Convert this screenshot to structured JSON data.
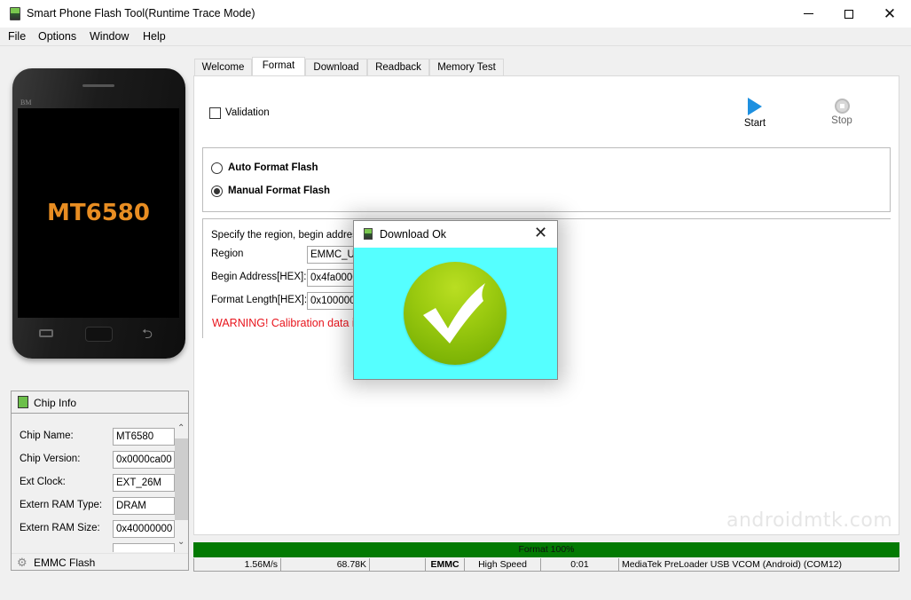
{
  "window": {
    "title": "Smart Phone Flash Tool(Runtime Trace Mode)",
    "controls": {
      "minimize": "minimize",
      "maximize": "maximize",
      "close": "✕"
    }
  },
  "menu": [
    "File",
    "Options",
    "Window",
    "Help"
  ],
  "phone": {
    "brand": "BM",
    "chip": "MT6580"
  },
  "chip_info": {
    "title": "Chip Info",
    "rows": [
      {
        "label": "Chip Name:",
        "value": "MT6580"
      },
      {
        "label": "Chip Version:",
        "value": "0x0000ca00"
      },
      {
        "label": "Ext Clock:",
        "value": "EXT_26M"
      },
      {
        "label": "Extern RAM Type:",
        "value": "DRAM"
      },
      {
        "label": "Extern RAM Size:",
        "value": "0x40000000"
      }
    ],
    "scroll_up": "^",
    "scroll_down": "v",
    "footer_label": "EMMC Flash"
  },
  "tabs": [
    {
      "label": "Welcome",
      "active": false
    },
    {
      "label": "Format",
      "active": true
    },
    {
      "label": "Download",
      "active": false
    },
    {
      "label": "Readback",
      "active": false
    },
    {
      "label": "Memory Test",
      "active": false
    }
  ],
  "format_tab": {
    "validation_label": "Validation",
    "validation_checked": false,
    "start_label": "Start",
    "stop_label": "Stop",
    "auto_format_label": "Auto Format Flash",
    "manual_format_label": "Manual Format Flash",
    "selected_mode": "Manual Format Flash",
    "manual_description": "Specify the region, begin address",
    "fields": [
      {
        "label": "Region",
        "value": "EMMC_USER"
      },
      {
        "label": "Begin Address[HEX]:",
        "value": "0x4fa0000"
      },
      {
        "label": "Format Length[HEX]:",
        "value": "0x100000"
      }
    ],
    "warning": "WARNING! Calibration data i"
  },
  "watermark": "androidmtk.com",
  "progress": {
    "label": "Format 100%",
    "percent": 100,
    "color": "#037a03"
  },
  "status_bar": [
    {
      "value": "1.56M/s",
      "align": "right"
    },
    {
      "value": "68.78K",
      "align": "right"
    },
    {
      "value": "",
      "align": "center"
    },
    {
      "value": "EMMC",
      "align": "center",
      "bold": true
    },
    {
      "value": "High Speed",
      "align": "center"
    },
    {
      "value": "0:01",
      "align": "center"
    },
    {
      "value": "MediaTek PreLoader USB VCOM (Android) (COM12)",
      "align": "left"
    }
  ],
  "dialog": {
    "title": "Download Ok",
    "close": "✕",
    "background": "#55ffff",
    "icon": "check-circle-icon"
  }
}
